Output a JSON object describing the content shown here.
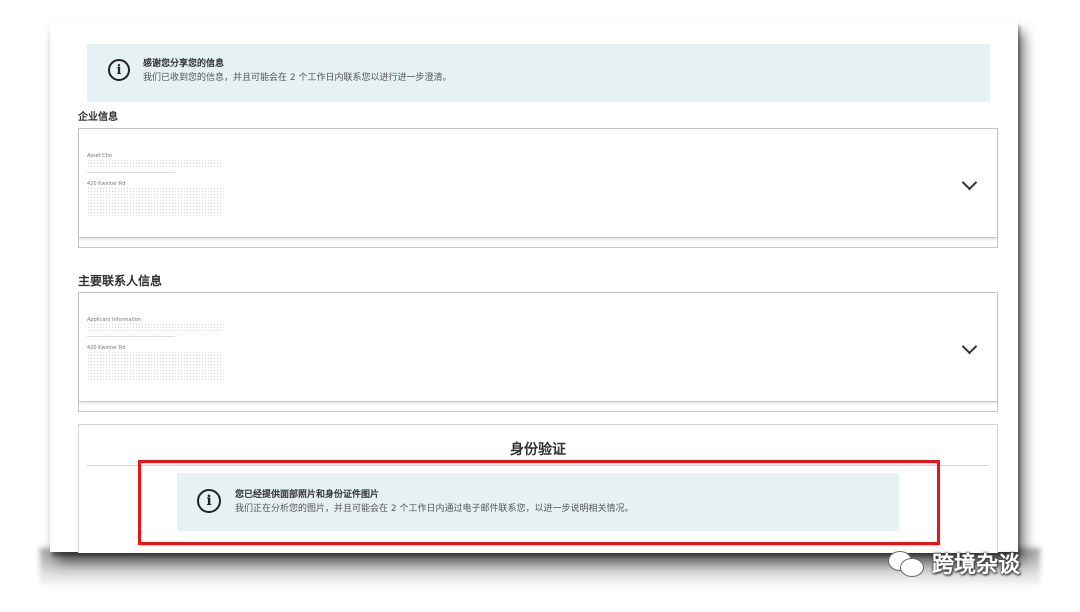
{
  "notice": {
    "title": "感谢您分享您的信息",
    "text": "我们已收到您的信息，并且可能会在 2 个工作日内联系您以进行进一步澄清。"
  },
  "company_info": {
    "label": "企业信息",
    "line1": "Asset Cho",
    "line2": "420 Kwinter Rd"
  },
  "contact_info": {
    "label": "主要联系人信息",
    "line1": "Applicant Information",
    "line2": "420 Kwinter Rd"
  },
  "identity": {
    "title": "身份验证",
    "banner_title": "您已经提供面部照片和身份证件图片",
    "banner_text": "我们正在分析您的图片，并且可能会在 2 个工作日内通过电子邮件联系您，以进一步说明相关情况。"
  },
  "watermark": {
    "text": "跨境杂谈"
  },
  "colors": {
    "banner_bg": "#e6f1f3",
    "highlight": "#e8141a"
  },
  "icons": [
    "info-icon",
    "chevron-down-icon",
    "wechat-icon"
  ]
}
